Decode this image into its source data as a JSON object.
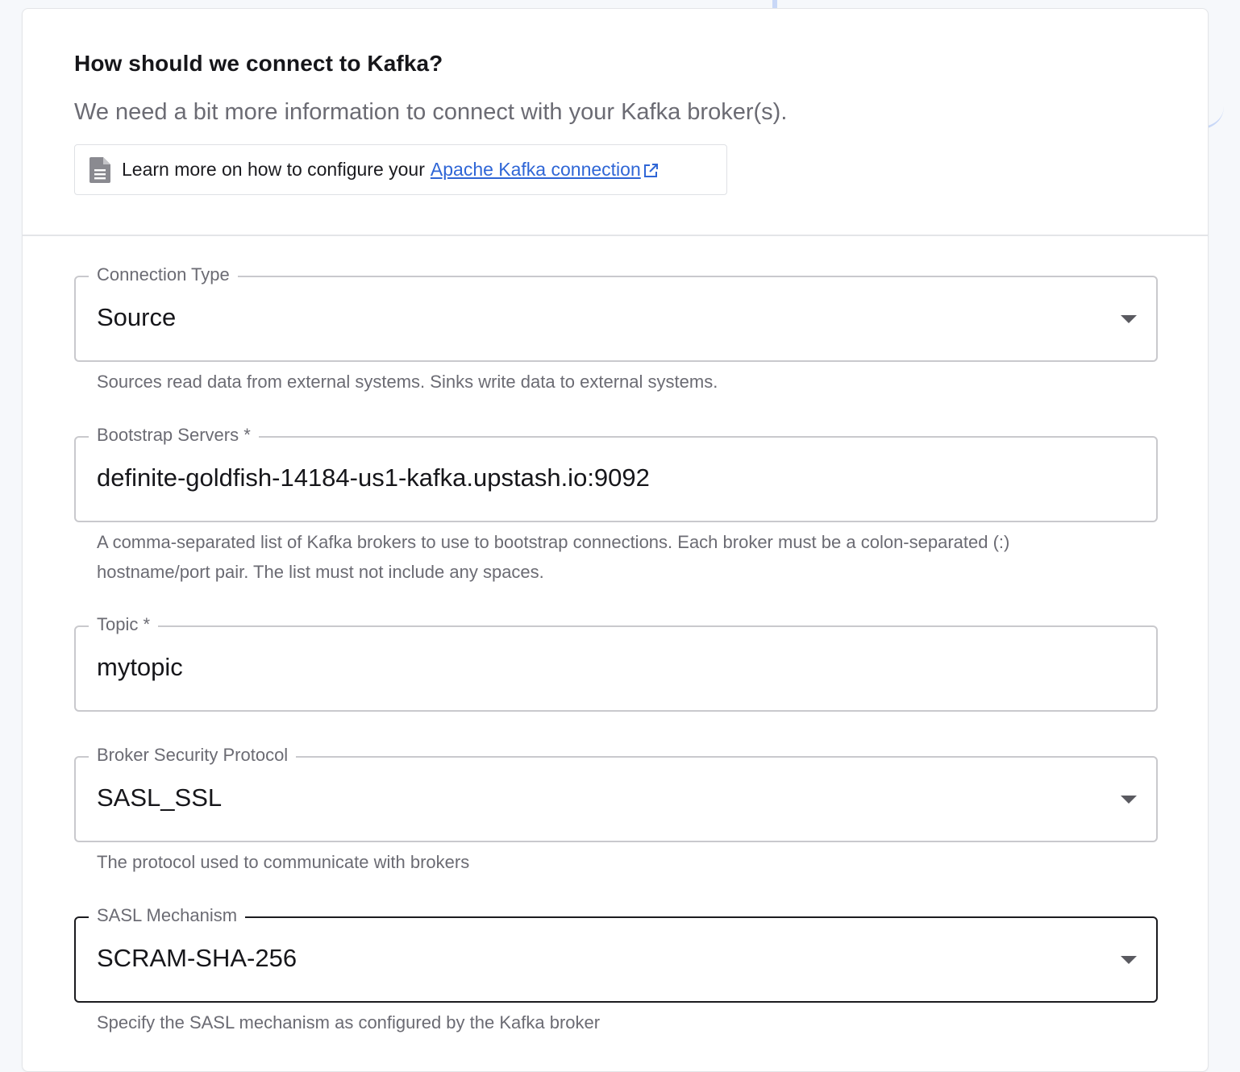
{
  "header": {
    "title": "How should we connect to Kafka?",
    "subtitle": "We need a bit more information to connect with your Kafka broker(s).",
    "learn_more_prefix": "Learn more on how to configure your",
    "learn_more_link": "Apache Kafka connection"
  },
  "fields": {
    "connection_type": {
      "label": "Connection Type",
      "value": "Source",
      "helper": "Sources read data from external systems. Sinks write data to external systems."
    },
    "bootstrap_servers": {
      "label": "Bootstrap Servers *",
      "value": "definite-goldfish-14184-us1-kafka.upstash.io:9092",
      "helper": "A comma-separated list of Kafka brokers to use to bootstrap connections. Each broker must be a colon-separated (:) hostname/port pair. The list must not include any spaces."
    },
    "topic": {
      "label": "Topic *",
      "value": "mytopic"
    },
    "broker_security_protocol": {
      "label": "Broker Security Protocol",
      "value": "SASL_SSL",
      "helper": "The protocol used to communicate with brokers"
    },
    "sasl_mechanism": {
      "label": "SASL Mechanism",
      "value": "SCRAM-SHA-256",
      "helper": "Specify the SASL mechanism as configured by the Kafka broker"
    }
  },
  "icons": {
    "document": "document-icon",
    "external_link": "external-link-icon",
    "dropdown": "caret-down-icon"
  },
  "colors": {
    "link": "#2f66d6",
    "focused_border": "#1b1b1f",
    "border": "#c9c9cd",
    "muted_text": "#6b6b73"
  }
}
